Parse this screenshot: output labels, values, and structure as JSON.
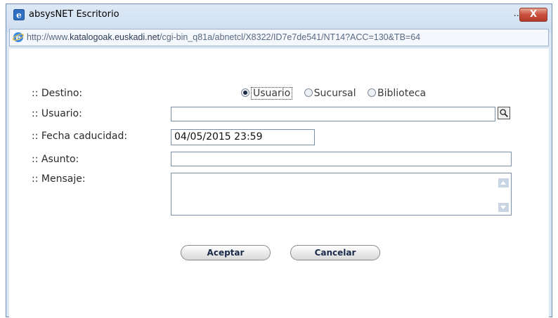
{
  "window": {
    "title": "absysNET Escritorio",
    "minimize_label": "...",
    "close_label": "X"
  },
  "urlbar": {
    "prefix": "http://www.",
    "domain": "katalogoak.euskadi.net",
    "path": "/cgi-bin_q81a/abnetcl/X8322/ID7e7de541/NT14?ACC=130&TB=64"
  },
  "form": {
    "destino_label": ":: Destino:",
    "usuario_label": ":: Usuario:",
    "fecha_label": ":: Fecha caducidad:",
    "asunto_label": ":: Asunto:",
    "mensaje_label": ":: Mensaje:",
    "destino_options": [
      "Usuario",
      "Sucursal",
      "Biblioteca"
    ],
    "destino_selected": "Usuario",
    "usuario_value": "",
    "fecha_value": "04/05/2015 23:59",
    "asunto_value": "",
    "mensaje_value": ""
  },
  "buttons": {
    "accept_label": "Aceptar",
    "cancel_label": "Cancelar"
  },
  "icons": {
    "title": "ie-icon",
    "url": "ie-icon",
    "search": "search-icon"
  }
}
